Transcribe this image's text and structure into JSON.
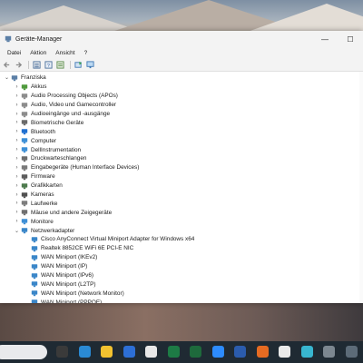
{
  "window": {
    "title": "Geräte-Manager",
    "controls": {
      "minimize": "—",
      "maximize": "☐"
    }
  },
  "menu": [
    "Datei",
    "Aktion",
    "Ansicht",
    "?"
  ],
  "tree": [
    {
      "label": "Franziska",
      "level": 0,
      "expander": "⌄",
      "icon": "computer-icon"
    },
    {
      "label": "Akkus",
      "level": 1,
      "expander": "›",
      "icon": "battery-icon"
    },
    {
      "label": "Audio Processing Objects (APOs)",
      "level": 1,
      "expander": "›",
      "icon": "audio-icon"
    },
    {
      "label": "Audio, Video und Gamecontroller",
      "level": 1,
      "expander": "›",
      "icon": "speaker-icon"
    },
    {
      "label": "Audioeingänge und -ausgänge",
      "level": 1,
      "expander": "›",
      "icon": "speaker-icon"
    },
    {
      "label": "Biometrische Geräte",
      "level": 1,
      "expander": "›",
      "icon": "fingerprint-icon"
    },
    {
      "label": "Bluetooth",
      "level": 1,
      "expander": "›",
      "icon": "bluetooth-icon"
    },
    {
      "label": "Computer",
      "level": 1,
      "expander": "›",
      "icon": "monitor-icon"
    },
    {
      "label": "DellInstrumentation",
      "level": 1,
      "expander": "›",
      "icon": "monitor-icon"
    },
    {
      "label": "Druckwarteschlangen",
      "level": 1,
      "expander": "›",
      "icon": "printer-icon"
    },
    {
      "label": "Eingabegeräte (Human Interface Devices)",
      "level": 1,
      "expander": "›",
      "icon": "hid-icon"
    },
    {
      "label": "Firmware",
      "level": 1,
      "expander": "›",
      "icon": "chip-icon"
    },
    {
      "label": "Grafikkarten",
      "level": 1,
      "expander": "›",
      "icon": "display-adapter-icon"
    },
    {
      "label": "Kameras",
      "level": 1,
      "expander": "›",
      "icon": "camera-icon"
    },
    {
      "label": "Laufwerke",
      "level": 1,
      "expander": "›",
      "icon": "drive-icon"
    },
    {
      "label": "Mäuse und andere Zeigegeräte",
      "level": 1,
      "expander": "›",
      "icon": "mouse-icon"
    },
    {
      "label": "Monitore",
      "level": 1,
      "expander": "›",
      "icon": "monitor-icon"
    },
    {
      "label": "Netzwerkadapter",
      "level": 1,
      "expander": "⌄",
      "icon": "network-adapter-icon"
    },
    {
      "label": "Cisco AnyConnect Virtual Miniport Adapter for Windows x64",
      "level": 2,
      "expander": "",
      "icon": "network-adapter-icon"
    },
    {
      "label": "Realtek 8852CE WiFi 6E PCI-E NIC",
      "level": 2,
      "expander": "",
      "icon": "network-adapter-icon"
    },
    {
      "label": "WAN Miniport (IKEv2)",
      "level": 2,
      "expander": "",
      "icon": "network-adapter-icon"
    },
    {
      "label": "WAN Miniport (IP)",
      "level": 2,
      "expander": "",
      "icon": "network-adapter-icon"
    },
    {
      "label": "WAN Miniport (IPv6)",
      "level": 2,
      "expander": "",
      "icon": "network-adapter-icon"
    },
    {
      "label": "WAN Miniport (L2TP)",
      "level": 2,
      "expander": "",
      "icon": "network-adapter-icon"
    },
    {
      "label": "WAN Miniport (Network Monitor)",
      "level": 2,
      "expander": "",
      "icon": "network-adapter-icon"
    },
    {
      "label": "WAN Miniport (PPPOE)",
      "level": 2,
      "expander": "",
      "icon": "network-adapter-icon"
    }
  ],
  "taskbar_icons": [
    {
      "name": "search-box",
      "color": "#e9eaec"
    },
    {
      "name": "task-view-icon",
      "color": "#3a3a3a"
    },
    {
      "name": "edge-icon",
      "color": "#2a8ad4"
    },
    {
      "name": "file-explorer-icon",
      "color": "#f2c230"
    },
    {
      "name": "store-icon",
      "color": "#2d6fd6"
    },
    {
      "name": "slack-icon",
      "color": "#e8e8e8"
    },
    {
      "name": "excel-icon",
      "color": "#1d7b45"
    },
    {
      "name": "app-icon",
      "color": "#1e6a3c"
    },
    {
      "name": "zoom-icon",
      "color": "#2d8cff"
    },
    {
      "name": "word-icon",
      "color": "#2b5cad"
    },
    {
      "name": "firefox-icon",
      "color": "#e66b22"
    },
    {
      "name": "chrome-icon",
      "color": "#eaeaea"
    },
    {
      "name": "teams-icon",
      "color": "#38b6d0"
    },
    {
      "name": "settings-icon",
      "color": "#7c8790"
    },
    {
      "name": "device-manager-icon",
      "color": "#5c6b78"
    }
  ]
}
